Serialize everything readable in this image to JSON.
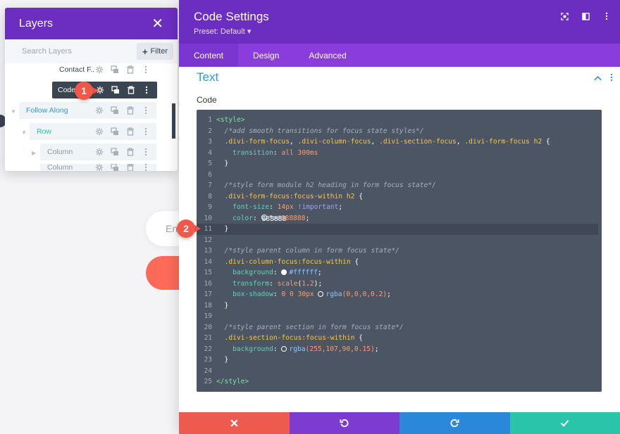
{
  "background": {
    "input_placeholder": "En"
  },
  "layers_panel": {
    "title": "Layers",
    "search_placeholder": "Search Layers",
    "filter_label": "Filter",
    "items": [
      {
        "label": "Contact F...",
        "color": "#3b4552"
      },
      {
        "label": "Code",
        "color": "#ffffff"
      },
      {
        "label": "Follow Along",
        "color": "#2e9ad6"
      },
      {
        "label": "Row",
        "color": "#29c4a9"
      },
      {
        "label": "Column",
        "color": "#8b96a3"
      },
      {
        "label": "Column",
        "color": "#8b96a3"
      }
    ]
  },
  "callouts": [
    "1",
    "2"
  ],
  "modal": {
    "title": "Code Settings",
    "preset": "Preset: Default ▾",
    "tabs": [
      "Content",
      "Design",
      "Advanced"
    ],
    "active_tab": "Content",
    "section_title": "Text",
    "field_label": "Code"
  },
  "code_lines": [
    "<style>",
    "  /*add smooth transitions for focus state styles*/",
    "  .divi-form-focus, .divi-column-focus, .divi-section-focus, .divi-form-focus h2 {",
    "    transition: all 300ms",
    "  }",
    "",
    "  /*style form module h2 heading in form focus state*/",
    "  .divi-form-focus:focus-within h2 {",
    "    font-size: 14px !important;",
    "    color: #888888;",
    "  }",
    "",
    "  /*style parent column in form focus state*/",
    "  .divi-column-focus:focus-within {",
    "    background: #ffffff;",
    "    transform: scale(1.2);",
    "    box-shadow: 0 0 30px rgba(0,0,0,0.2);",
    "  }",
    "",
    "  /*style parent section in form focus state*/",
    "  .divi-section-focus:focus-within {",
    "    background: rgba(255,107,90,0.15);",
    "  }",
    "",
    "</style>"
  ],
  "highlighted_line": 11,
  "colors": {
    "header_purple": "#6c2ec0",
    "tab_purple": "#8a3ddc",
    "code_bg": "#4b5563",
    "cancel": "#ef5a4e",
    "undo": "#7d3bd1",
    "redo": "#2b87da",
    "save": "#29c4a9",
    "callout": "#f2584a",
    "accent_blue": "#2e9ad6"
  },
  "footer_buttons": [
    "close-icon",
    "undo-icon",
    "redo-icon",
    "check-icon"
  ]
}
